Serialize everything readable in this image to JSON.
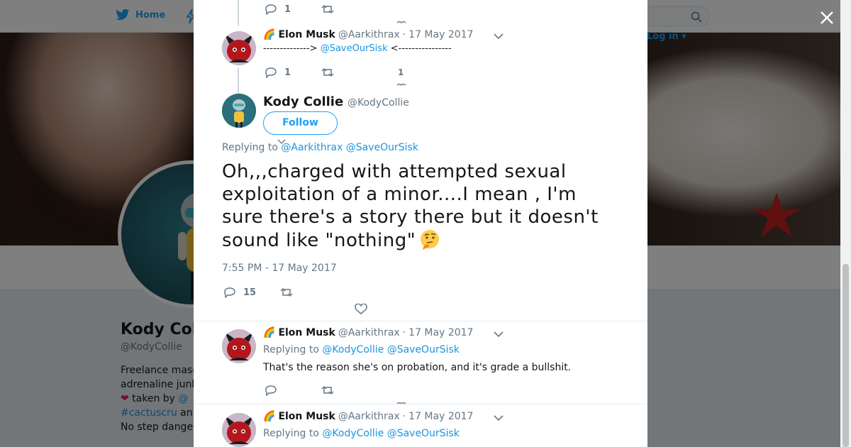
{
  "nav": {
    "home_label": "Home",
    "login_label": "Log in"
  },
  "profile": {
    "name": "Kody Col",
    "handle": "@KodyCollie",
    "bio_lines": [
      {
        "text": "Freelance masc"
      },
      {
        "text": "adrenaline junk"
      },
      {
        "heart": "❤",
        "text": " taken by ",
        "link": "@"
      },
      {
        "link": "#cactuscru",
        "text": " an"
      },
      {
        "text": "No step dange"
      }
    ]
  },
  "thread": {
    "top": {
      "reply_count": "1"
    },
    "reply1": {
      "rainbow": "🌈",
      "name": "Elon Musk",
      "handle": "@Aarkithrax",
      "dot": "·",
      "date": "17 May 2017",
      "text_pre": "--------------> ",
      "text_mention": "@SaveOurSisk",
      "text_post": " <----------------",
      "reply_count": "1",
      "like_count": "1"
    },
    "main": {
      "name": "Kody Collie",
      "handle": "@KodyCollie",
      "follow_label": "Follow",
      "replying_prefix": "Replying to ",
      "replying_to": [
        "@Aarkithrax",
        "@SaveOurSisk"
      ],
      "text": "Oh,,,charged with attempted sexual exploitation of a minor....I mean , I'm sure there's a story there but it doesn't sound like \"nothing\"",
      "emoji": "thinking-face",
      "time": "7:55 PM - 17 May 2017",
      "reply_count": "15"
    },
    "reply2": {
      "rainbow": "🌈",
      "name": "Elon Musk",
      "handle": "@Aarkithrax",
      "dot": "·",
      "date": "17 May 2017",
      "replying_prefix": "Replying to ",
      "replying_to": [
        "@KodyCollie",
        "@SaveOurSisk"
      ],
      "text": "That's the reason she's on probation, and it's grade a bullshit."
    },
    "reply3": {
      "rainbow": "🌈",
      "name": "Elon Musk",
      "handle": "@Aarkithrax",
      "dot": "·",
      "date": "17 May 2017",
      "replying_prefix": "Replying to ",
      "replying_to": [
        "@KodyCollie",
        "@SaveOurSisk"
      ]
    }
  },
  "colors": {
    "brand": "#1da1f2",
    "link": "#1b95e0",
    "muted": "#657786",
    "heart": "#e0245e"
  },
  "icons": [
    "twitter-bird-icon",
    "moments-icon",
    "search-icon",
    "close-icon",
    "reply-icon",
    "retweet-icon",
    "like-icon",
    "caret-down-icon",
    "thinking-face-icon"
  ]
}
